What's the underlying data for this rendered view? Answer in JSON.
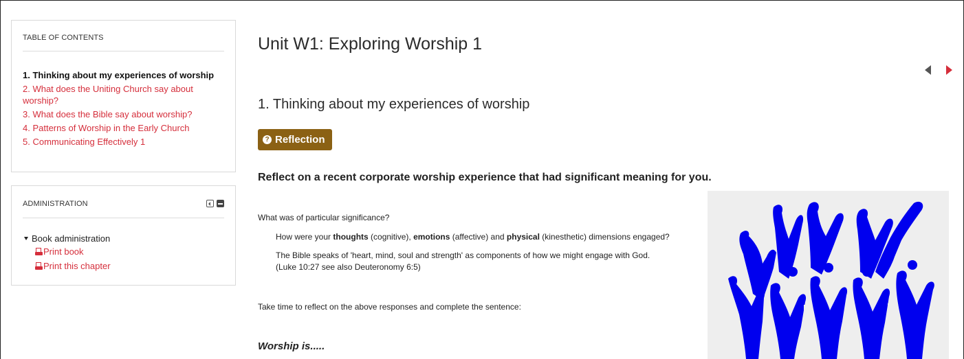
{
  "toc": {
    "title": "TABLE OF CONTENTS",
    "items": [
      {
        "label": "1. Thinking about my experiences of worship"
      },
      {
        "label": "2. What does the Uniting Church say about worship?"
      },
      {
        "label": "3. What does the Bible say about worship?"
      },
      {
        "label": "4. Patterns of Worship in the Early Church"
      },
      {
        "label": "5. Communicating Effectively 1"
      }
    ]
  },
  "admin": {
    "title": "ADMINISTRATION",
    "node_label": "Book administration",
    "print_book": "Print book",
    "print_chapter": "Print this chapter"
  },
  "main": {
    "page_title": "Unit W1: Exploring Worship 1",
    "chapter_title": "1. Thinking about my experiences of worship",
    "badge_label": "Reflection",
    "prompt": "Reflect on a recent corporate worship experience that had significant meaning for you.",
    "q1": "What was of particular significance?",
    "q2": {
      "a": "How were your ",
      "b": "thoughts",
      "c": " (cognitive), ",
      "d": "emotions",
      "e": " (affective) and ",
      "f": "physical",
      "g": " (kinesthetic) dimensions engaged?"
    },
    "q3_line1": "The Bible speaks of 'heart, mind, soul and strength' as components of how we might engage with God.",
    "q3_line2": "(Luke 10:27 see also Deuteronomy 6:5)",
    "q4": "Take time to reflect on the above responses and complete the sentence:",
    "worship": "Worship is....."
  },
  "colors": {
    "link": "#d52e3b",
    "badge": "#8b6114",
    "figure": "#0000ee"
  }
}
